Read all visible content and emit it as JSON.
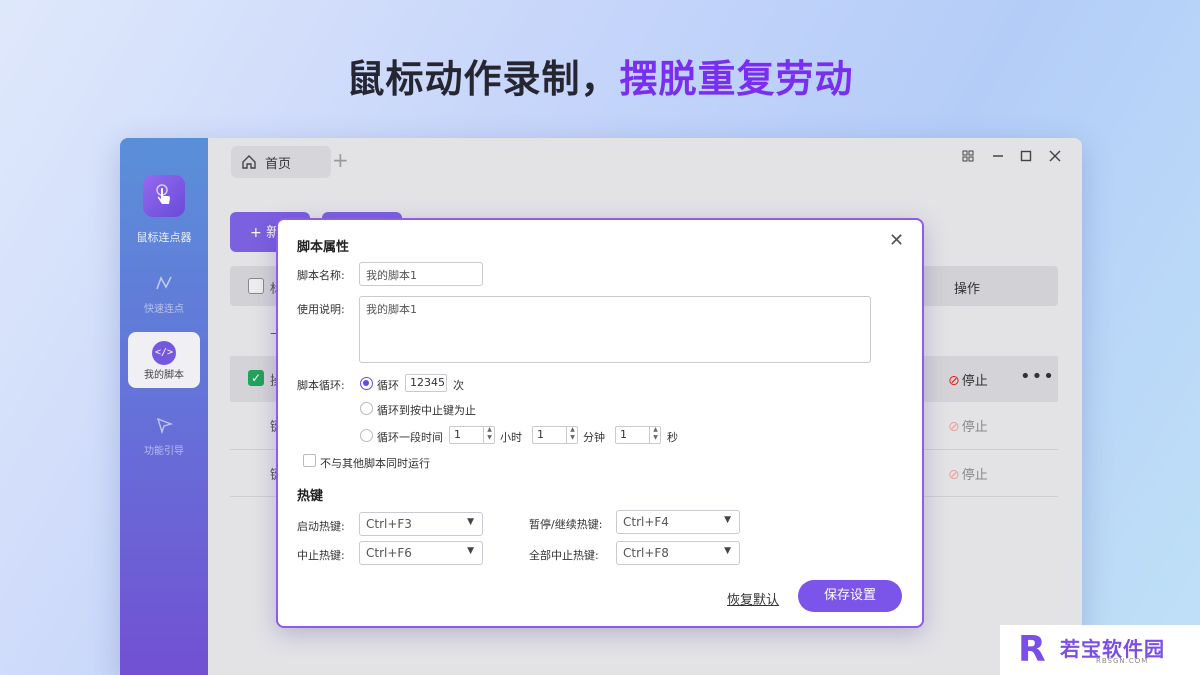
{
  "headline": {
    "part1": "鼠标动作录制，",
    "part2": "摆脱重复劳动"
  },
  "sidebar": {
    "app_name": "鼠标连点器",
    "items": [
      {
        "label": "快速连点",
        "icon": "zigzag-icon"
      },
      {
        "label": "我的脚本",
        "icon": "code-icon",
        "icon_text": "</>"
      },
      {
        "label": "功能引导",
        "icon": "send-icon"
      }
    ]
  },
  "tabs": [
    {
      "label": "首页"
    }
  ],
  "toolbar": {
    "new_button_label": "+ 新"
  },
  "table": {
    "head_stub": "标",
    "op_header": "操作",
    "row_stubs": [
      "—",
      "操",
      "键",
      "键"
    ],
    "stop_label": "停止",
    "more_glyph": "•••"
  },
  "modal": {
    "title": "脚本属性",
    "name_label": "脚本名称:",
    "name_value": "我的脚本1",
    "desc_label": "使用说明:",
    "desc_value": "我的脚本1",
    "loop_label": "脚本循环:",
    "loop_opt1": "循环",
    "loop_count": "12345",
    "loop_unit": "次",
    "loop_opt2": "循环到按中止键为止",
    "loop_opt3": "循环一段时间",
    "hours": "1",
    "hours_unit": "小时",
    "minutes": "1",
    "minutes_unit": "分钟",
    "seconds": "1",
    "seconds_unit": "秒",
    "exclusive_label": "不与其他脚本同时运行",
    "hotkey_section": "热键",
    "start_label": "启动热键:",
    "start_value": "Ctrl+F3",
    "pause_label": "暂停/继续热键:",
    "pause_value": "Ctrl+F4",
    "stop_label": "中止热键:",
    "stop_value": "Ctrl+F6",
    "stop_all_label": "全部中止热键:",
    "stop_all_value": "Ctrl+F8",
    "reset_label": "恢复默认",
    "save_label": "保存设置"
  },
  "watermark": {
    "brand": "若宝软件园",
    "domain": "RBSGN.COM",
    "accent": "#7c4ee8"
  },
  "colors": {
    "accent": "#6a4ae0",
    "stop_red": "#e0281b",
    "checked_green": "#22a35a"
  }
}
